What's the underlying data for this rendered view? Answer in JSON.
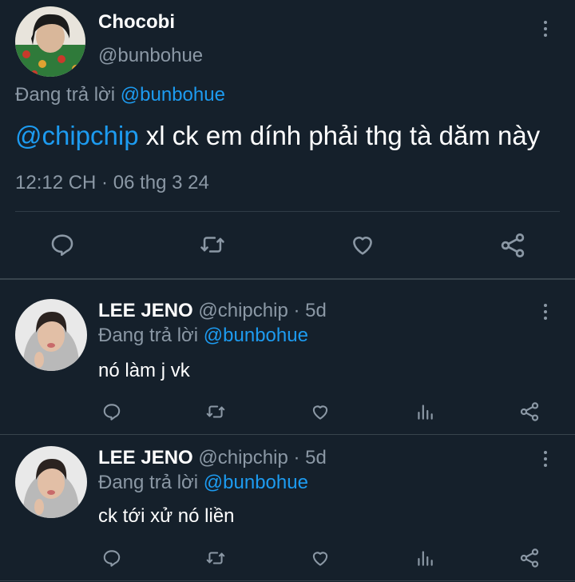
{
  "main_tweet": {
    "display_name": "Chocobi",
    "handle": "@bunbohue",
    "reply_prefix": "Đang trả lời",
    "reply_to": "@bunbohue",
    "mention": "@chipchip",
    "text": " xl ck em dính phải thg tà dăm này",
    "timestamp": "12:12 CH · 06 thg 3 24"
  },
  "replies": [
    {
      "display_name": "LEE JENO",
      "handle": "@chipchip",
      "time": "· 5d",
      "reply_prefix": "Đang trả lời",
      "reply_to": "@bunbohue",
      "text": "nó làm j vk"
    },
    {
      "display_name": "LEE JENO",
      "handle": "@chipchip",
      "time": "· 5d",
      "reply_prefix": "Đang trả lời",
      "reply_to": "@bunbohue",
      "text": "ck tới xử nó liền"
    }
  ],
  "icons": {
    "reply": "reply-icon",
    "retweet": "retweet-icon",
    "like": "heart-icon",
    "analytics": "analytics-icon",
    "share": "share-icon",
    "more": "more-vertical-icon"
  },
  "colors": {
    "background": "#15202b",
    "accent": "#1d9bf0",
    "muted": "#8b98a5",
    "divider": "#38444d"
  }
}
